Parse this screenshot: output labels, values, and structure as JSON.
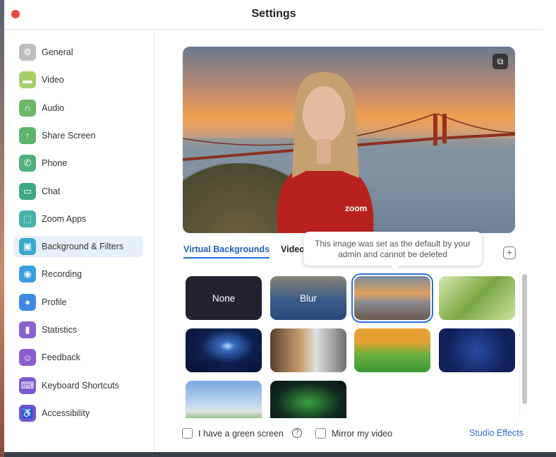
{
  "window": {
    "title": "Settings"
  },
  "sidebar": {
    "items": [
      {
        "label": "General",
        "icon": "gear-icon",
        "color": "#bdbdbd"
      },
      {
        "label": "Video",
        "icon": "video-camera-icon",
        "color": "#a6cf6a"
      },
      {
        "label": "Audio",
        "icon": "headphones-icon",
        "color": "#6ab86a"
      },
      {
        "label": "Share Screen",
        "icon": "share-screen-icon",
        "color": "#5cb56a"
      },
      {
        "label": "Phone",
        "icon": "phone-icon",
        "color": "#4fb07a"
      },
      {
        "label": "Chat",
        "icon": "chat-icon",
        "color": "#3fa882"
      },
      {
        "label": "Zoom Apps",
        "icon": "apps-icon",
        "color": "#45b3a8"
      },
      {
        "label": "Background & Filters",
        "icon": "background-icon",
        "color": "#3aa7d0",
        "selected": true
      },
      {
        "label": "Recording",
        "icon": "record-icon",
        "color": "#3aa0e0"
      },
      {
        "label": "Profile",
        "icon": "profile-icon",
        "color": "#3d8ae0"
      },
      {
        "label": "Statistics",
        "icon": "statistics-icon",
        "color": "#8a62d0"
      },
      {
        "label": "Feedback",
        "icon": "feedback-icon",
        "color": "#8a5cd0"
      },
      {
        "label": "Keyboard Shortcuts",
        "icon": "keyboard-icon",
        "color": "#7a5ad0"
      },
      {
        "label": "Accessibility",
        "icon": "accessibility-icon",
        "color": "#6a58d0"
      }
    ]
  },
  "preview": {
    "shirt_text": "zoom"
  },
  "tabs": [
    {
      "label": "Virtual Backgrounds",
      "active": true
    },
    {
      "label": "Video"
    }
  ],
  "tooltip": {
    "line1": "This image was set as the default by your",
    "line2": "admin and cannot be deleted"
  },
  "backgrounds": [
    {
      "label": "None"
    },
    {
      "label": "Blur"
    },
    {
      "label": "",
      "name": "golden-gate-bridge",
      "selected": true
    },
    {
      "label": "",
      "name": "grass"
    },
    {
      "label": "",
      "name": "earth-from-space"
    },
    {
      "label": "",
      "name": "office"
    },
    {
      "label": "",
      "name": "camper-van"
    },
    {
      "label": "",
      "name": "pattern"
    },
    {
      "label": "",
      "name": "beach"
    },
    {
      "label": "",
      "name": "aurora"
    }
  ],
  "footer": {
    "green_screen": "I have a green screen",
    "mirror": "Mirror my video",
    "studio_effects": "Studio Effects"
  },
  "colors": {
    "accent": "#2f6fd8",
    "link": "#2d6cc9"
  }
}
